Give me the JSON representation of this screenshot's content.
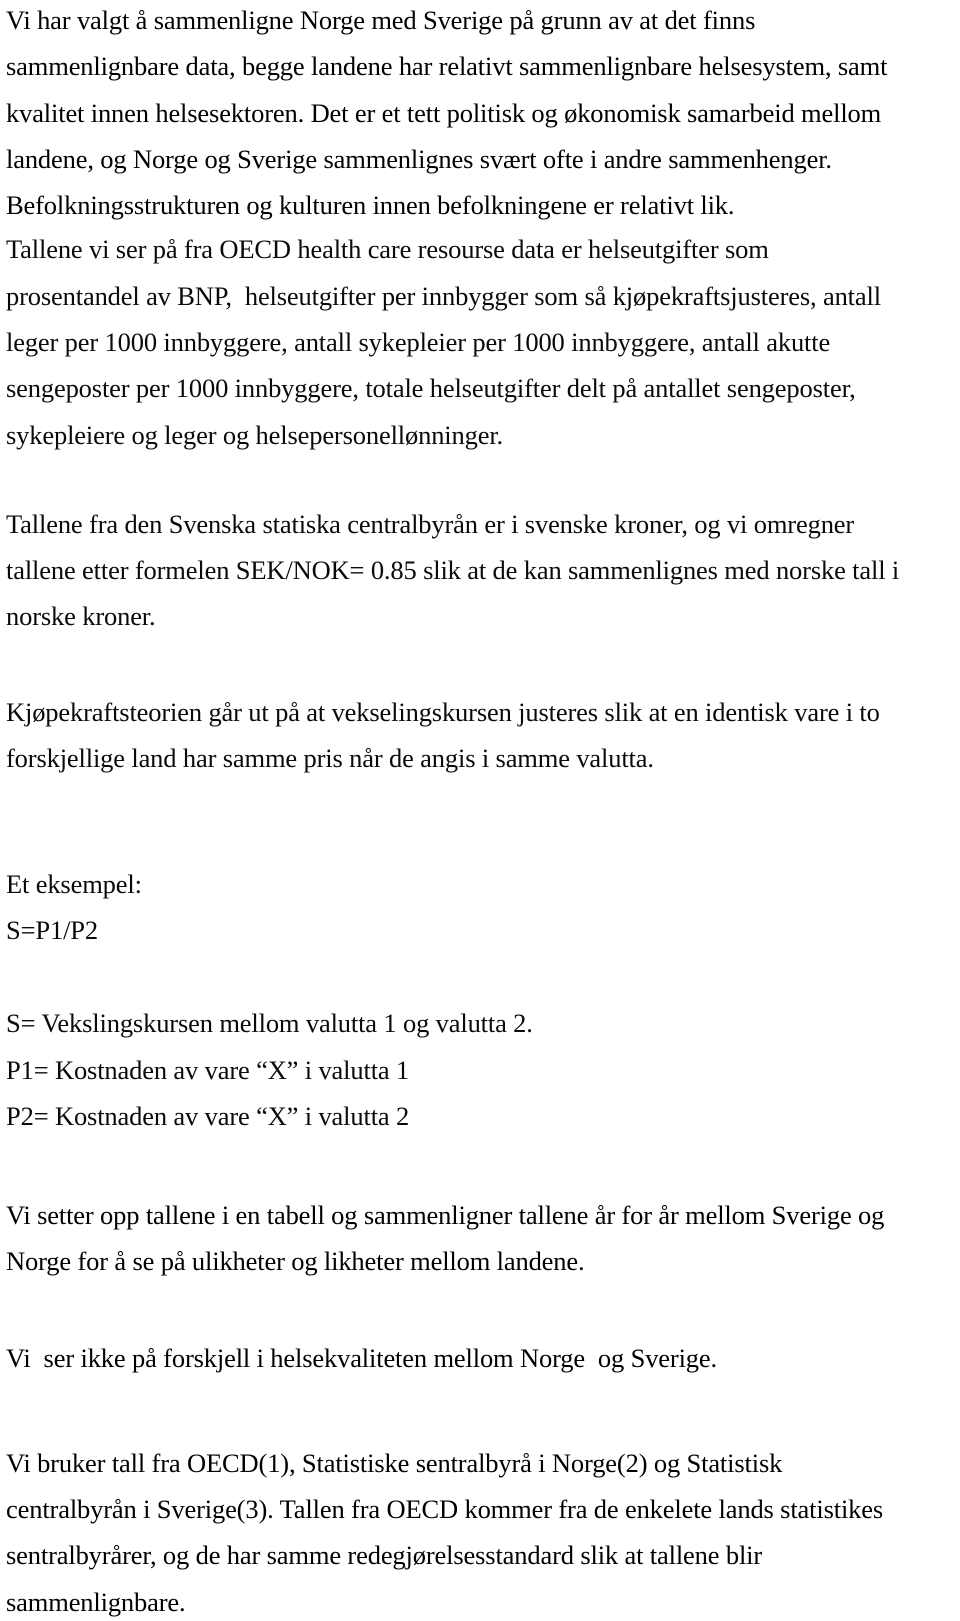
{
  "document": {
    "language": "Norwegian",
    "background_color": "#ffffff",
    "text_color": "#000000",
    "paragraphs": [
      {
        "id": "p1",
        "name": "paragraph-comparison-rationale",
        "lines": [
          "Vi har valgt å sammenligne Norge med Sverige på grunn av at det finns",
          "sammenlignbare data, begge landene har relativt sammenlignbare helsesystem, samt",
          "kvalitet innen helsesektoren. Det er et tett politisk og økonomisk samarbeid mellom",
          "landene, og Norge og Sverige sammenlignes svært ofte i andre sammenhenger.",
          "Befolkningsstrukturen og kulturen innen befolkningene er relativt lik."
        ]
      },
      {
        "id": "p2",
        "name": "paragraph-oecd-indicators",
        "lines": [
          "Tallene vi ser på fra OECD health care resourse data er helseutgifter som",
          "prosentandel av BNP,  helseutgifter per innbygger som så kjøpekraftsjusteres, antall",
          "leger per 1000 innbyggere, antall sykepleier per 1000 innbyggere, antall akutte",
          "sengeposter per 1000 innbyggere, totale helseutgifter delt på antallet sengeposter,",
          "sykepleiere og leger og helsepersonellønninger."
        ]
      },
      {
        "id": "p3",
        "name": "paragraph-currency-conversion",
        "lines": [
          "Tallene fra den Svenska statiska centralbyrån er i svenske kroner, og vi omregner",
          "tallene etter formelen SEK/NOK= 0.85 slik at de kan sammenlignes med norske tall i",
          "norske kroner."
        ]
      },
      {
        "id": "p4",
        "name": "paragraph-ppp-theory",
        "lines": [
          "Kjøpekraftsteorien går ut på at vekselingskursen justeres slik at en identisk vare i to",
          "forskjellige land har samme pris når de angis i samme valutta."
        ]
      },
      {
        "id": "p5",
        "name": "paragraph-example-heading",
        "lines": [
          "Et eksempel:",
          "S=P1/P2"
        ]
      },
      {
        "id": "p6",
        "name": "paragraph-formula-legend",
        "lines": [
          "S= Vekslingskursen mellom valutta 1 og valutta 2.",
          "P1= Kostnaden av vare “X” i valutta 1",
          "P2= Kostnaden av vare “X” i valutta 2"
        ]
      },
      {
        "id": "p7",
        "name": "paragraph-table-method",
        "lines": [
          "Vi setter opp tallene i en tabell og sammenligner tallene år for år mellom Sverige og",
          "Norge for å se på ulikheter og likheter mellom landene."
        ]
      },
      {
        "id": "p8",
        "name": "paragraph-quality-scope",
        "lines": [
          "Vi  ser ikke på forskjell i helsekvaliteten mellom Norge  og Sverige."
        ]
      },
      {
        "id": "p9",
        "name": "paragraph-sources",
        "lines": [
          "Vi bruker tall fra OECD(1), Statistiske sentralbyrå i Norge(2) og Statistisk",
          "centralbyrån i Sverige(3). Tallen fra OECD kommer fra de enkelete lands statistikes",
          "sentralbyrårer, og de har samme redegjørelsesstandard slik at tallene blir",
          "sammenlignbare."
        ]
      }
    ]
  },
  "layout": {
    "line_tops": {
      "p1": [
        5,
        51,
        98,
        144,
        190
      ],
      "p2": [
        234,
        281,
        327,
        373,
        420
      ],
      "p3": [
        509,
        555,
        601
      ],
      "p4": [
        697,
        743
      ],
      "p5": [
        869,
        915
      ],
      "p6": [
        1008,
        1055,
        1101
      ],
      "p7": [
        1200,
        1246
      ],
      "p8": [
        1343
      ],
      "p9": [
        1448,
        1494,
        1540,
        1587
      ]
    }
  }
}
